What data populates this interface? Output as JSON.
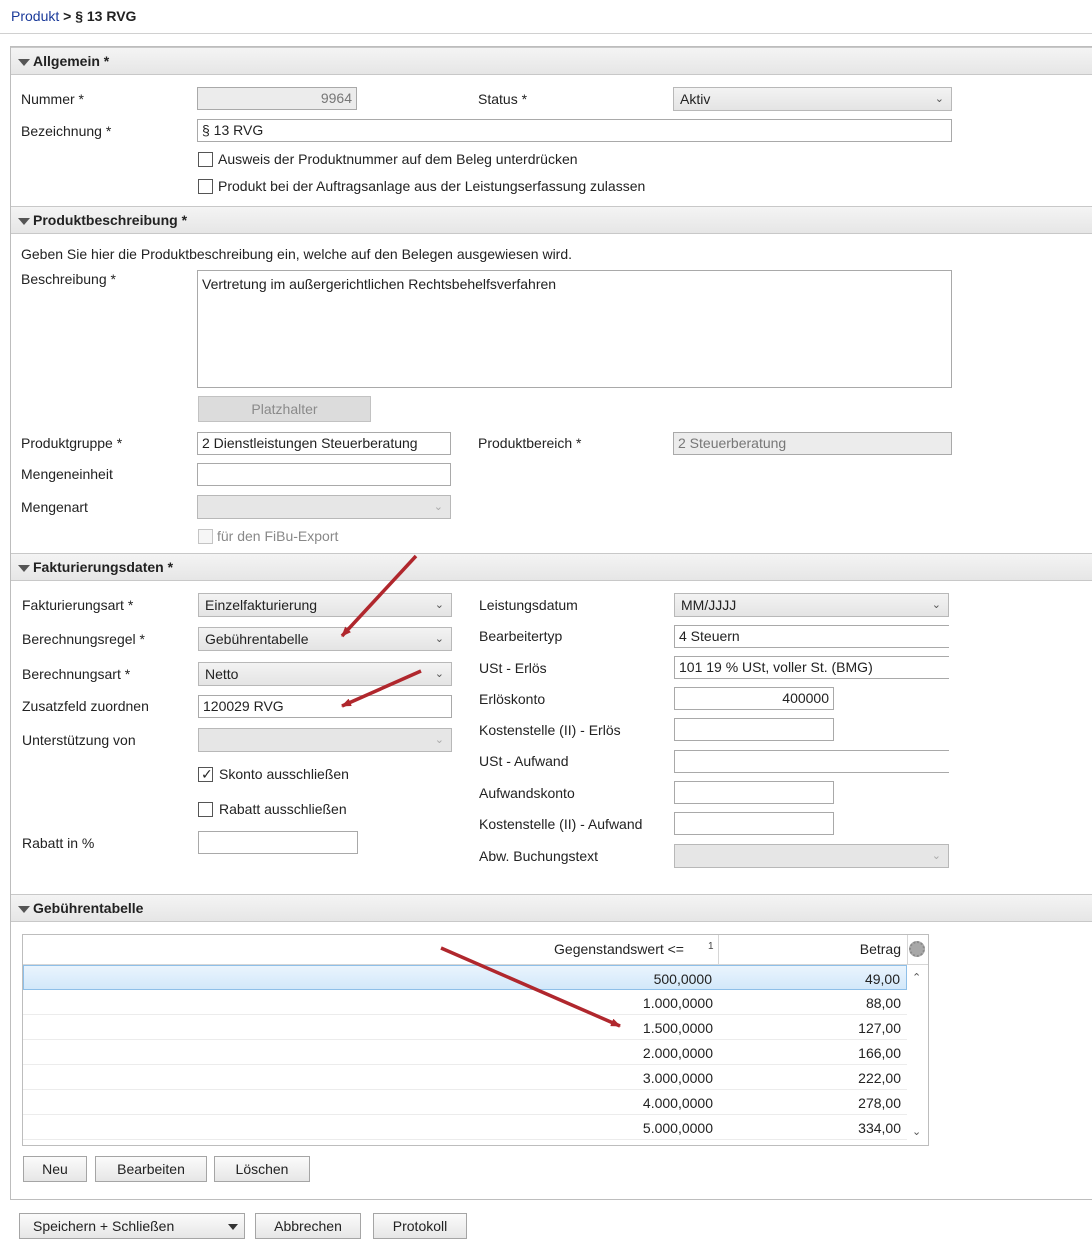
{
  "breadcrumb": {
    "root": "Produkt",
    "separator": ">",
    "current": "§ 13 RVG"
  },
  "allgemein": {
    "title": "Allgemein *",
    "nummer_label": "Nummer *",
    "nummer_value": "9964",
    "status_label": "Status *",
    "status_value": "Aktiv",
    "bezeichnung_label": "Bezeichnung *",
    "bezeichnung_value": "§ 13 RVG",
    "cb1_label": "Ausweis der Produktnummer auf dem Beleg unterdrücken",
    "cb2_label": "Produkt bei der Auftragsanlage aus der Leistungserfassung zulassen"
  },
  "produktbeschreibung": {
    "title": "Produktbeschreibung *",
    "hint": "Geben Sie hier die Produktbeschreibung ein, welche auf den Belegen ausgewiesen wird.",
    "beschreibung_label": "Beschreibung *",
    "beschreibung_value": "Vertretung im außergerichtlichen Rechtsbehelfsverfahren",
    "platzhalter_label": "Platzhalter",
    "produktgruppe_label": "Produktgruppe *",
    "produktgruppe_value": "2   Dienstleistungen Steuerberatung",
    "produktbereich_label": "Produktbereich *",
    "produktbereich_value": "2   Steuerberatung",
    "mengeneinheit_label": "Mengeneinheit",
    "mengeneinheit_value": "",
    "mengenart_label": "Mengenart",
    "mengenart_value": "",
    "fibu_label": "für den FiBu-Export"
  },
  "fakturierung": {
    "title": "Fakturierungsdaten *",
    "fakturierungsart_label": "Fakturierungsart *",
    "fakturierungsart_value": "Einzelfakturierung",
    "berechnungsregel_label": "Berechnungsregel *",
    "berechnungsregel_value": "Gebührentabelle",
    "berechnungsart_label": "Berechnungsart *",
    "berechnungsart_value": "Netto",
    "zusatzfeld_label": "Zusatzfeld zuordnen",
    "zusatzfeld_value": "120029   RVG",
    "unterstuetzung_label": "Unterstützung von",
    "unterstuetzung_value": "",
    "skonto_label": "Skonto ausschließen",
    "rabatt_cb_label": "Rabatt ausschließen",
    "rabatt_label": "Rabatt in %",
    "rabatt_value": "",
    "leistungsdatum_label": "Leistungsdatum",
    "leistungsdatum_value": "MM/JJJJ",
    "bearbeitertyp_label": "Bearbeitertyp",
    "bearbeitertyp_value": "4   Steuern",
    "ust_erloes_label": "USt - Erlös",
    "ust_erloes_value": "101     19 % USt, voller St. (BMG)",
    "erloeskonto_label": "Erlöskonto",
    "erloeskonto_value": "400000",
    "kst_erloes_label": "Kostenstelle (II) - Erlös",
    "kst_erloes_value": "",
    "ust_aufwand_label": "USt - Aufwand",
    "ust_aufwand_value": "",
    "aufwandskonto_label": "Aufwandskonto",
    "aufwandskonto_value": "",
    "kst_aufwand_label": "Kostenstelle (II) - Aufwand",
    "kst_aufwand_value": "",
    "buchungstext_label": "Abw. Buchungstext",
    "buchungstext_value": ""
  },
  "gebuehrentabelle": {
    "title": "Gebührentabelle",
    "col1": "Gegenstandswert <=",
    "col1_sort": "1",
    "col2": "Betrag",
    "rows": [
      {
        "wert": "500,0000",
        "betrag": "49,00"
      },
      {
        "wert": "1.000,0000",
        "betrag": "88,00"
      },
      {
        "wert": "1.500,0000",
        "betrag": "127,00"
      },
      {
        "wert": "2.000,0000",
        "betrag": "166,00"
      },
      {
        "wert": "3.000,0000",
        "betrag": "222,00"
      },
      {
        "wert": "4.000,0000",
        "betrag": "278,00"
      },
      {
        "wert": "5.000,0000",
        "betrag": "334,00"
      }
    ],
    "neu": "Neu",
    "bearbeiten": "Bearbeiten",
    "loeschen": "Löschen"
  },
  "footer": {
    "speichern": "Speichern + Schließen",
    "abbrechen": "Abbrechen",
    "protokoll": "Protokoll"
  },
  "colors": {
    "link": "#1a3a9a",
    "arrow": "#b0272d",
    "selected_row": "#d3e8fa"
  }
}
